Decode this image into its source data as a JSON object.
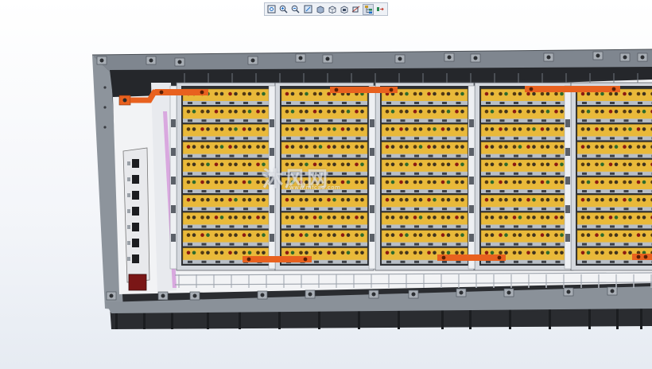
{
  "toolbar": {
    "buttons": [
      {
        "icon": "zoom-fit-icon",
        "active": false
      },
      {
        "icon": "zoom-in-icon",
        "active": false
      },
      {
        "icon": "zoom-out-icon",
        "active": false
      },
      {
        "icon": "zoom-window-icon",
        "active": false
      },
      {
        "icon": "shaded-view-icon",
        "active": false
      },
      {
        "icon": "wireframe-view-icon",
        "active": false
      },
      {
        "icon": "hidden-line-icon",
        "active": false
      },
      {
        "icon": "section-view-icon",
        "active": false
      },
      {
        "icon": "model-tree-icon",
        "active": true
      },
      {
        "icon": "explode-icon",
        "active": false
      }
    ]
  },
  "model": {
    "battery_modules": 5,
    "colors": {
      "frame": "#7f868f",
      "frame_dark": "#2a2c30",
      "cell_yellow": "#e9b93a",
      "busbar_orange": "#e8611f",
      "terminal_red": "#8b1a12",
      "terminal_green": "#2e6b2c",
      "rail_gray": "#c9ced6"
    }
  },
  "watermark": {
    "text": "沐风网",
    "url": "www.mfcad.com"
  }
}
